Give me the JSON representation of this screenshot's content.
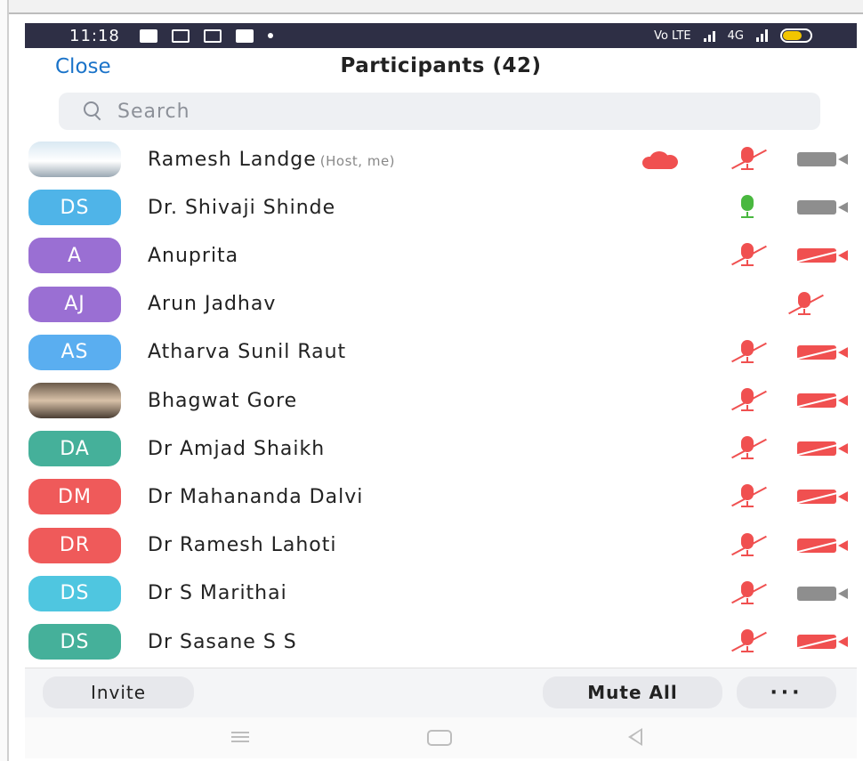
{
  "status_bar": {
    "time": "11:18",
    "network_text": "Vo LTE",
    "signal_text": "4G",
    "battery_color": "#f2c500"
  },
  "header": {
    "close_label": "Close",
    "title": "Participants (42)"
  },
  "search": {
    "placeholder": "Search"
  },
  "participants": [
    {
      "initials": "",
      "name": "Ramesh Landge",
      "role": "(Host, me)",
      "avatar": "photo",
      "avatar_color": "",
      "cloud": true,
      "mic": "muted",
      "video": "on"
    },
    {
      "initials": "DS",
      "name": "Dr. Shivaji Shinde",
      "role": "",
      "avatar": "initials",
      "avatar_color": "#4fb4e8",
      "cloud": false,
      "mic": "on",
      "video": "on"
    },
    {
      "initials": "A",
      "name": "Anuprita",
      "role": "",
      "avatar": "initials",
      "avatar_color": "#9a6fd3",
      "cloud": false,
      "mic": "muted",
      "video": "off"
    },
    {
      "initials": "AJ",
      "name": "Arun Jadhav",
      "role": "",
      "avatar": "initials",
      "avatar_color": "#9a6fd3",
      "cloud": false,
      "mic": "muted",
      "video": "none"
    },
    {
      "initials": "AS",
      "name": "Atharva Sunil Raut",
      "role": "",
      "avatar": "initials",
      "avatar_color": "#5aaef0",
      "cloud": false,
      "mic": "muted",
      "video": "off"
    },
    {
      "initials": "",
      "name": "Bhagwat Gore",
      "role": "",
      "avatar": "photo2",
      "avatar_color": "",
      "cloud": false,
      "mic": "muted",
      "video": "off"
    },
    {
      "initials": "DA",
      "name": "Dr Amjad Shaikh",
      "role": "",
      "avatar": "initials",
      "avatar_color": "#45b09a",
      "cloud": false,
      "mic": "muted",
      "video": "off"
    },
    {
      "initials": "DM",
      "name": "Dr Mahananda Dalvi",
      "role": "",
      "avatar": "initials",
      "avatar_color": "#ef5a5a",
      "cloud": false,
      "mic": "muted",
      "video": "off"
    },
    {
      "initials": "DR",
      "name": "Dr Ramesh Lahoti",
      "role": "",
      "avatar": "initials",
      "avatar_color": "#ef5a5a",
      "cloud": false,
      "mic": "muted",
      "video": "off"
    },
    {
      "initials": "DS",
      "name": "Dr S Marithai",
      "role": "",
      "avatar": "initials",
      "avatar_color": "#4fc6e0",
      "cloud": false,
      "mic": "muted",
      "video": "on"
    },
    {
      "initials": "DS",
      "name": "Dr Sasane S S",
      "role": "",
      "avatar": "initials",
      "avatar_color": "#45b09a",
      "cloud": false,
      "mic": "muted",
      "video": "off"
    }
  ],
  "footer": {
    "invite_label": "Invite",
    "mute_all_label": "Mute All",
    "more_label": "···"
  },
  "colors": {
    "accent": "#1a73c9",
    "muted_red": "#f05050",
    "active_green": "#49b83f",
    "video_gray": "#8e8e8e"
  }
}
